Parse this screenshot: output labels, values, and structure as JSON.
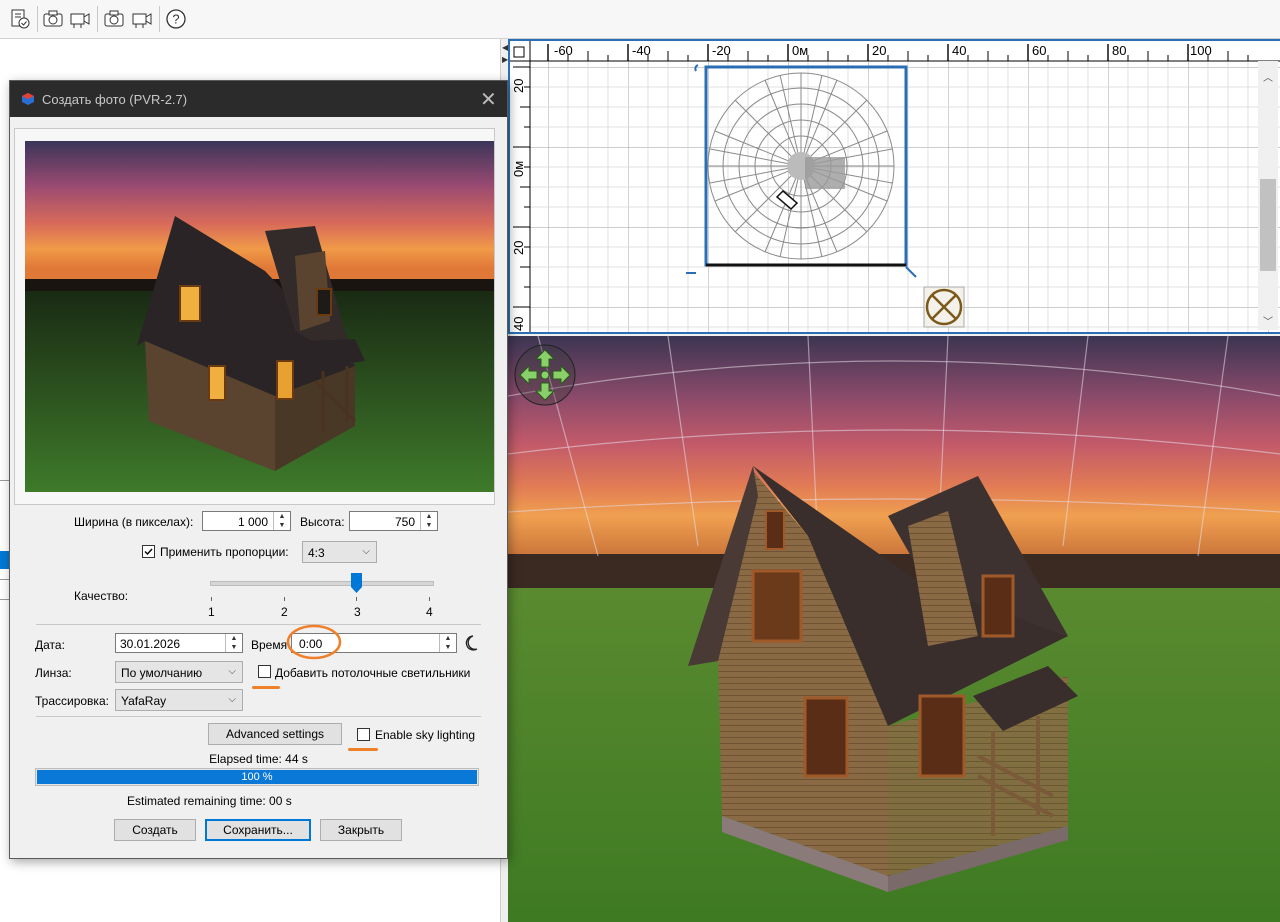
{
  "toolbar": {
    "icons": [
      "document-check-icon",
      "camera-icon",
      "video-camera-icon",
      "camera-icon",
      "video-camera-icon",
      "help-icon"
    ]
  },
  "plan": {
    "ruler_x": [
      "-60",
      "-40",
      "-20",
      "0м",
      "20",
      "40",
      "60",
      "80",
      "100"
    ],
    "ruler_y": [
      "20",
      "0м",
      "20",
      "40"
    ]
  },
  "dialog": {
    "title": "Создать фото (PVR-2.7)",
    "width_label": "Ширина (в пикселах):",
    "width_value": "1 000",
    "height_label": "Высота:",
    "height_value": "750",
    "proportions_label": "Применить пропорции:",
    "proportions_checked": true,
    "ratio_value": "4:3",
    "quality_label": "Качество:",
    "quality_ticks": [
      "1",
      "2",
      "3",
      "4"
    ],
    "quality_value": 3,
    "date_label": "Дата:",
    "date_value": "30.01.2026",
    "time_label": "Время",
    "time_value": "0:00",
    "lens_label": "Линза:",
    "lens_value": "По умолчанию",
    "ceiling_lights_label": "Добавить потолочные светильники",
    "tracer_label": "Трассировка:",
    "tracer_value": "YafaRay",
    "advanced_button": "Advanced settings",
    "sky_lighting_label": "Enable sky lighting",
    "elapsed": "Elapsed time: 44 s",
    "progress_text": "100 %",
    "progress_value": 1.0,
    "remaining": "Estimated remaining time: 00 s",
    "create_button": "Создать",
    "save_button": "Сохранить...",
    "close_button": "Закрыть"
  },
  "colors": {
    "accent": "#2a6fb5",
    "progress": "#0a78d7",
    "highlight": "#f07f2a",
    "title_bar": "#2b2b2b"
  }
}
